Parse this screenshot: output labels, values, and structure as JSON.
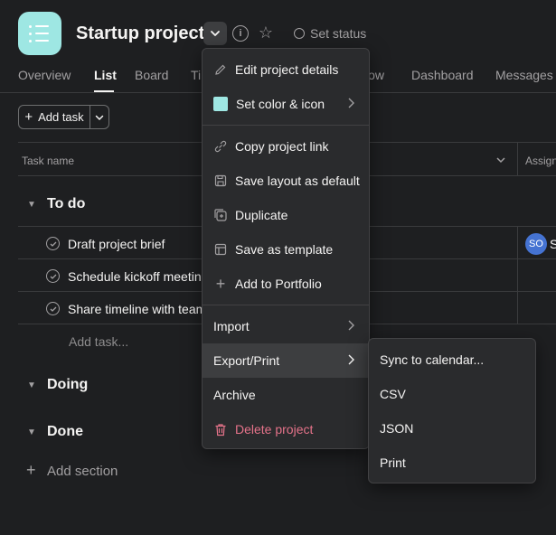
{
  "project": {
    "title": "Startup project",
    "set_status_label": "Set status",
    "icon_name": "list-icon",
    "accent_color": "#9ee7e3"
  },
  "tabs": [
    {
      "label": "Overview"
    },
    {
      "label": "List"
    },
    {
      "label": "Board"
    },
    {
      "label": "Ti"
    },
    {
      "label": "low"
    },
    {
      "label": "Dashboard"
    },
    {
      "label": "Messages"
    }
  ],
  "toolbar": {
    "add_task_label": "Add task"
  },
  "table": {
    "col_task_name": "Task name",
    "col_assignee": "Assign"
  },
  "sections": [
    {
      "title": "To do"
    },
    {
      "title": "Doing"
    },
    {
      "title": "Done"
    }
  ],
  "tasks": [
    {
      "name": "Draft project brief",
      "assignee_initials": "SO",
      "assignee_name": "S"
    },
    {
      "name": "Schedule kickoff meeting"
    },
    {
      "name": "Share timeline with team"
    }
  ],
  "add_task_inline": "Add task...",
  "add_section_label": "Add section",
  "project_menu": {
    "items": [
      {
        "label": "Edit project details",
        "icon": "pencil-icon"
      },
      {
        "label": "Set color & icon",
        "icon": "color-swatch-icon"
      },
      {
        "label": "Copy project link",
        "icon": "link-icon"
      },
      {
        "label": "Save layout as default",
        "icon": "save-icon"
      },
      {
        "label": "Duplicate",
        "icon": "duplicate-icon"
      },
      {
        "label": "Save as template",
        "icon": "template-icon"
      },
      {
        "label": "Add to Portfolio",
        "icon": "plus-icon"
      },
      {
        "label": "Import"
      },
      {
        "label": "Export/Print"
      },
      {
        "label": "Archive"
      },
      {
        "label": "Delete project",
        "icon": "trash-icon"
      }
    ]
  },
  "export_menu": {
    "items": [
      {
        "label": "Sync to calendar..."
      },
      {
        "label": "CSV"
      },
      {
        "label": "JSON"
      },
      {
        "label": "Print"
      }
    ]
  },
  "colors": {
    "background": "#1e1f21",
    "menu_bg": "#2a2b2d",
    "danger": "#e5738a",
    "avatar": "#4573d2"
  }
}
